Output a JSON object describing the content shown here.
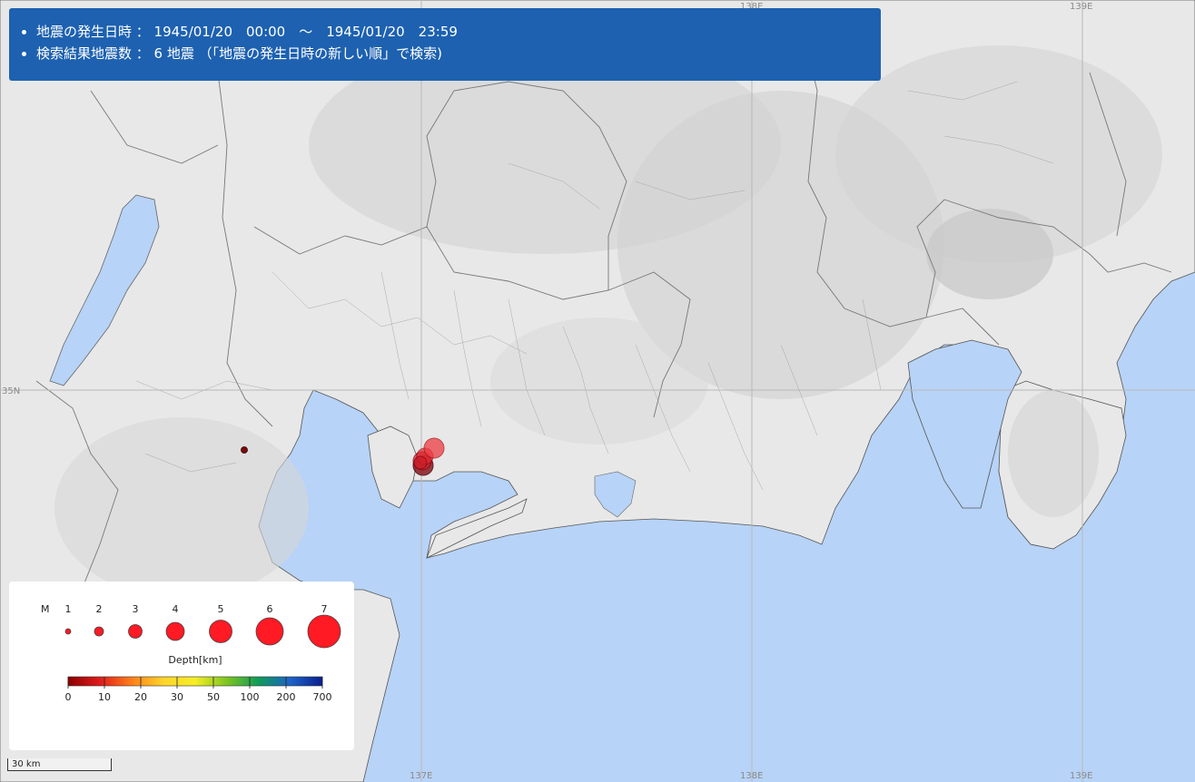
{
  "info": {
    "line1": "地震の発生日時 ： 1945/01/20　00:00　～　1945/01/20　23:59",
    "line2": "検索結果地震数 ： 6 地震 （「地震の発生日時の新しい順」で検索)"
  },
  "grid_labels": {
    "lon_137": "137E",
    "lon_138": "138E",
    "lon_139": "139E",
    "lat_35": "35N"
  },
  "legend": {
    "magnitude_label": "M",
    "magnitudes": [
      "1",
      "2",
      "3",
      "4",
      "5",
      "6",
      "7"
    ],
    "depth_title": "Depth[km]",
    "depth_ticks": [
      "0",
      "10",
      "20",
      "30",
      "50",
      "100",
      "200",
      "700"
    ],
    "depth_colors": [
      "#8b0000",
      "#e11c1c",
      "#ff7f1a",
      "#ffd52a",
      "#f6ee25",
      "#7cc520",
      "#0f9a5a",
      "#1e62c8",
      "#0a1f8f"
    ]
  },
  "scale_bar": "30 km",
  "colors": {
    "sea": "#b7d3f7",
    "land": "#eaeaea",
    "info_bg": "#1d61b0",
    "quake_fill": "#e0202a"
  },
  "earthquakes_visible": 6
}
